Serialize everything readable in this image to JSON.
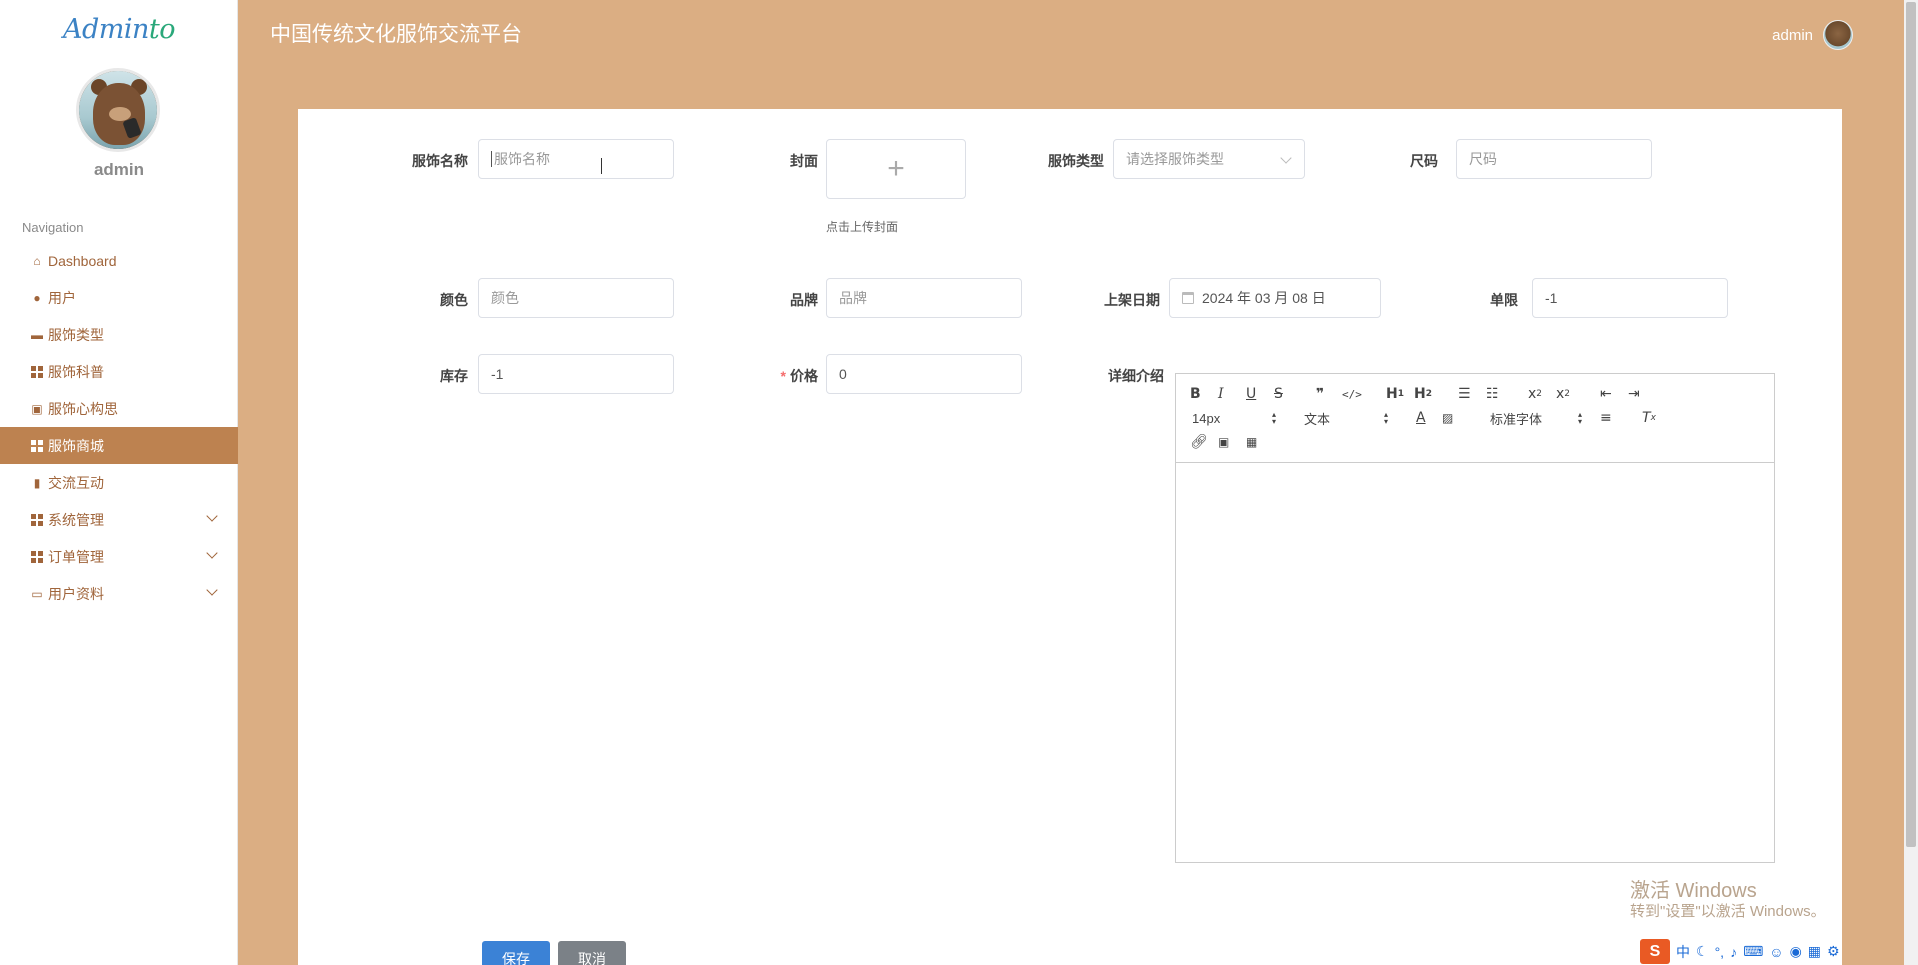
{
  "app": {
    "logo_main": "Admin",
    "logo_tail": "to",
    "title": "中国传统文化服饰交流平台"
  },
  "header": {
    "username": "admin"
  },
  "sidebar": {
    "username": "admin",
    "nav_title": "Navigation",
    "items": [
      {
        "label": "Dashboard",
        "icon": "home-icon"
      },
      {
        "label": "用户",
        "icon": "user-icon"
      },
      {
        "label": "服饰类型",
        "icon": "briefcase-icon"
      },
      {
        "label": "服饰科普",
        "icon": "grid-icon"
      },
      {
        "label": "服饰心构思",
        "icon": "clipboard-icon"
      },
      {
        "label": "服饰商城",
        "icon": "grid-icon",
        "active": true
      },
      {
        "label": "交流互动",
        "icon": "bar-chart-icon"
      },
      {
        "label": "系统管理",
        "icon": "grid-icon",
        "expandable": true
      },
      {
        "label": "订单管理",
        "icon": "grid-icon",
        "expandable": true
      },
      {
        "label": "用户资料",
        "icon": "id-card-icon",
        "expandable": true
      }
    ]
  },
  "form": {
    "name": {
      "label": "服饰名称",
      "placeholder": "服饰名称",
      "value": ""
    },
    "cover": {
      "label": "封面",
      "tip": "点击上传封面"
    },
    "type": {
      "label": "服饰类型",
      "placeholder": "请选择服饰类型"
    },
    "size": {
      "label": "尺码",
      "placeholder": "尺码"
    },
    "color": {
      "label": "颜色",
      "placeholder": "颜色"
    },
    "brand": {
      "label": "品牌",
      "placeholder": "品牌"
    },
    "date": {
      "label": "上架日期",
      "value": "2024 年 03 月 08 日"
    },
    "limit": {
      "label": "单限",
      "value": "-1"
    },
    "stock": {
      "label": "库存",
      "value": "-1"
    },
    "price": {
      "label": "价格",
      "value": "0",
      "required_mark": "*"
    },
    "detail": {
      "label": "详细介绍",
      "toolbar": {
        "font_size": "14px",
        "block_type": "文本",
        "font_family": "标准字体"
      }
    },
    "save_label": "保存",
    "cancel_label": "取消"
  },
  "watermark": {
    "line1": "激活 Windows",
    "line2": "转到\"设置\"以激活 Windows。"
  },
  "tray": {
    "ime_label": "中"
  },
  "colors": {
    "page_bg": "#dbae83",
    "active_nav": "#bd8250",
    "nav_text": "#a0653b",
    "primary_button": "#3b82d6",
    "secondary_button": "#7b8187"
  }
}
